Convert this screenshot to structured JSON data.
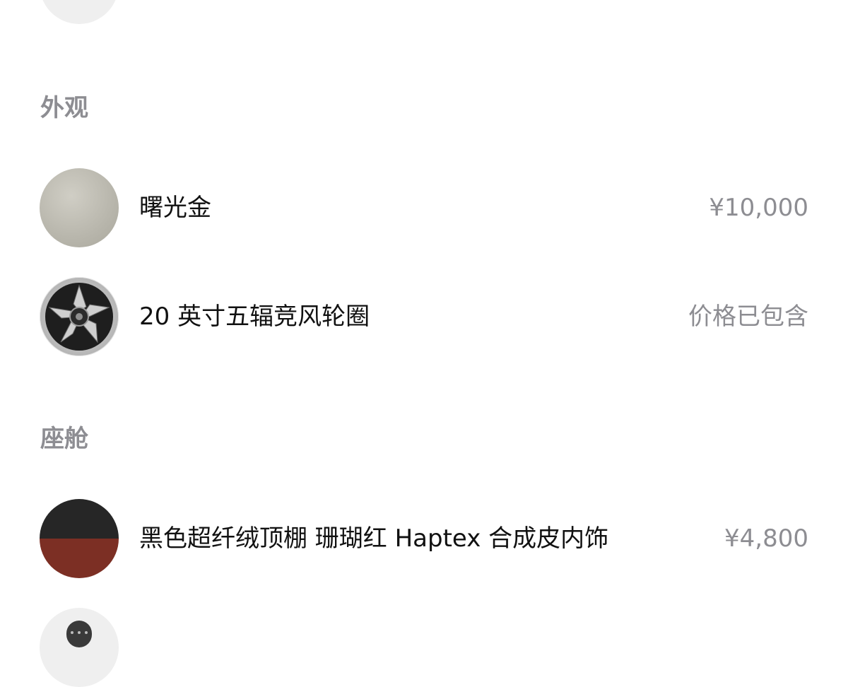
{
  "sections": {
    "exterior": {
      "title": "外观",
      "items": [
        {
          "label": "曙光金",
          "value": "¥10,000",
          "icon": "color-swatch-gold"
        },
        {
          "label": "20 英寸五辐竞风轮圈",
          "value": "价格已包含",
          "icon": "wheel-image"
        }
      ]
    },
    "cabin": {
      "title": "座舱",
      "items": [
        {
          "label": "黑色超纤绒顶棚 珊瑚红 Haptex 合成皮内饰",
          "value": "¥4,800",
          "icon": "interior-swatch"
        }
      ]
    }
  },
  "colors": {
    "gold_swatch": "#b8b6ac",
    "interior_top": "#262626",
    "interior_bottom": "#7c2f24",
    "section_title": "#8d8d92",
    "price_text": "#8d8d92"
  }
}
